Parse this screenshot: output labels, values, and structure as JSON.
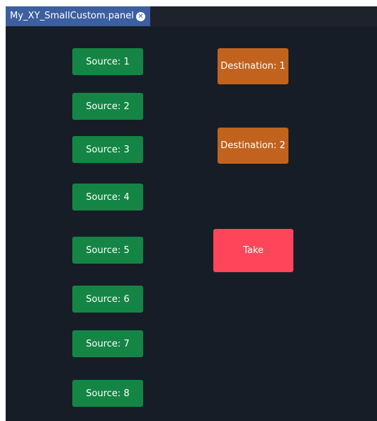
{
  "tab": {
    "title": "My_XY_SmallCustom.panel",
    "close_icon": "close-circle-icon"
  },
  "sources": [
    {
      "label": "Source: 1"
    },
    {
      "label": "Source: 2"
    },
    {
      "label": "Source: 3"
    },
    {
      "label": "Source: 4"
    },
    {
      "label": "Source: 5"
    },
    {
      "label": "Source: 6"
    },
    {
      "label": "Source: 7"
    },
    {
      "label": "Source: 8"
    }
  ],
  "destinations": [
    {
      "label": "Destination: 1"
    },
    {
      "label": "Destination: 2"
    }
  ],
  "take": {
    "label": "Take"
  },
  "colors": {
    "source": "#148544",
    "destination": "#c1631f",
    "take": "#ff4559",
    "panel_background": "#171d27",
    "tab": "#3c5fa0"
  }
}
